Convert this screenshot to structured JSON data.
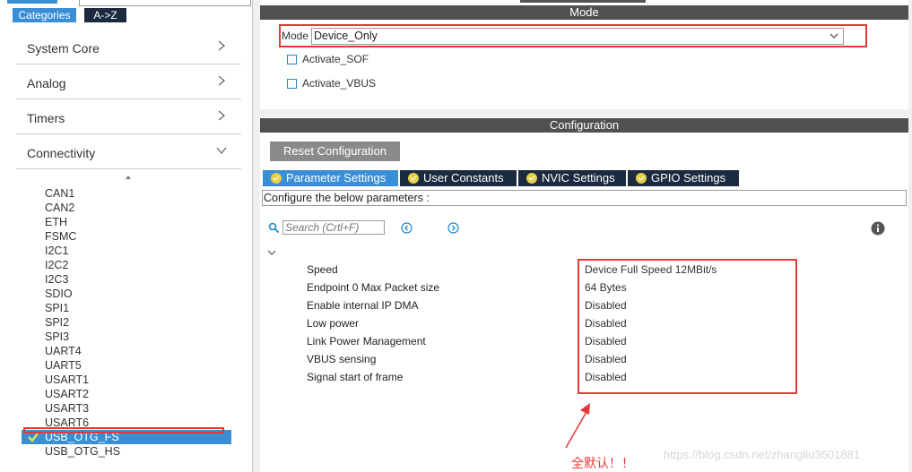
{
  "left_panel": {
    "tabs": {
      "categories": "Categories",
      "az": "A->Z"
    },
    "categories": [
      {
        "label": "System Core",
        "expanded": false
      },
      {
        "label": "Analog",
        "expanded": false
      },
      {
        "label": "Timers",
        "expanded": false
      },
      {
        "label": "Connectivity",
        "expanded": true
      }
    ],
    "peripherals": [
      "CAN1",
      "CAN2",
      "ETH",
      "FSMC",
      "I2C1",
      "I2C2",
      "I2C3",
      "SDIO",
      "SPI1",
      "SPI2",
      "SPI3",
      "UART4",
      "UART5",
      "USART1",
      "USART2",
      "USART3",
      "USART6",
      "USB_OTG_FS",
      "USB_OTG_HS"
    ],
    "selected": "USB_OTG_FS"
  },
  "mode_section": {
    "header": "Mode",
    "mode_label": "Mode",
    "mode_value": "Device_Only",
    "options": [
      {
        "label": "Activate_SOF",
        "checked": false
      },
      {
        "label": "Activate_VBUS",
        "checked": false
      }
    ]
  },
  "config_section": {
    "header": "Configuration",
    "reset_button": "Reset Configuration",
    "tabs": [
      "Parameter Settings",
      "User Constants",
      "NVIC Settings",
      "GPIO Settings"
    ],
    "active_tab": "Parameter Settings",
    "configure_text": "Configure the below parameters :",
    "search_placeholder": "Search (Crtl+F)",
    "parameters": [
      {
        "name": "Speed",
        "value": "Device Full Speed 12MBit/s"
      },
      {
        "name": "Endpoint 0 Max Packet size",
        "value": "64 Bytes"
      },
      {
        "name": "Enable internal IP DMA",
        "value": "Disabled"
      },
      {
        "name": "Low power",
        "value": "Disabled"
      },
      {
        "name": "Link Power Management",
        "value": "Disabled"
      },
      {
        "name": "VBUS sensing",
        "value": "Disabled"
      },
      {
        "name": "Signal start of frame",
        "value": "Disabled"
      }
    ]
  },
  "annotation": {
    "text": "全默认！！",
    "color": "#e53935"
  },
  "watermark": "https://blog.csdn.net/zhangliu3601881",
  "colors": {
    "accent": "#3a8ed6",
    "header": "#505050",
    "highlight": "#e53935",
    "tab_dark": "#1b2a3e"
  }
}
